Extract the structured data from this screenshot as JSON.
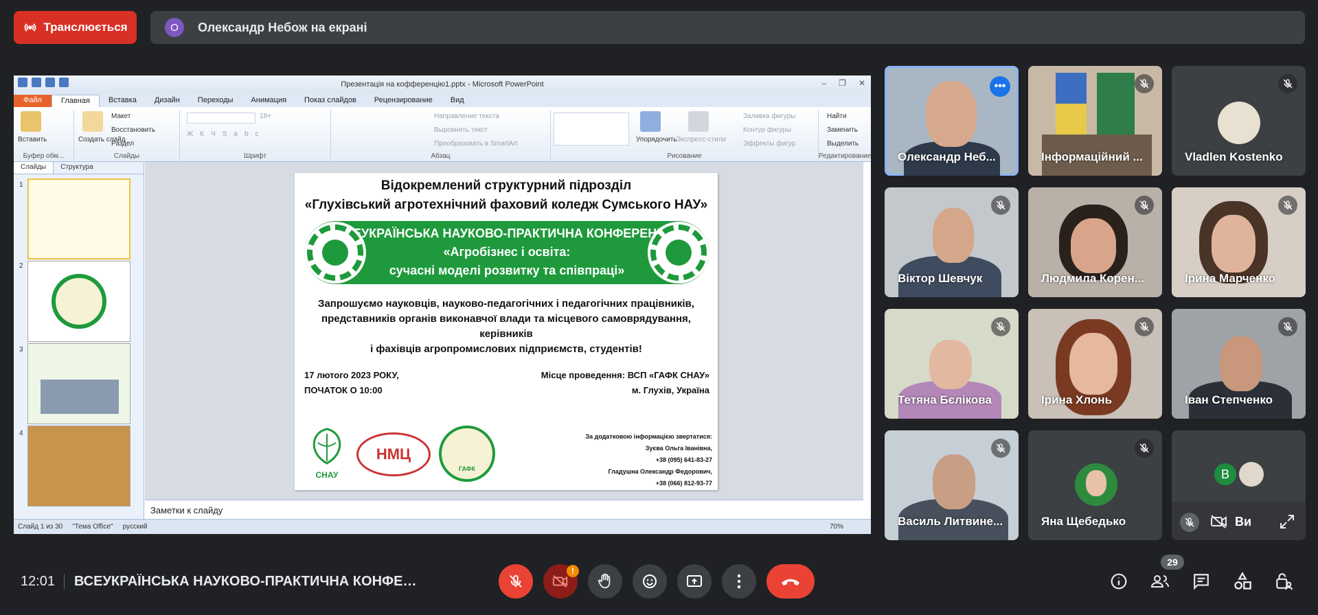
{
  "top": {
    "live_label": "Транслюється",
    "presenter_initial": "О",
    "presenter_text": "Олександр Небож на екрані"
  },
  "ppt": {
    "window_title": "Презентація на кофференцію1.pptx - Microsoft PowerPoint",
    "tabs": [
      "Файл",
      "Главная",
      "Вставка",
      "Дизайн",
      "Переходы",
      "Анимация",
      "Показ слайдов",
      "Рецензирование",
      "Вид"
    ],
    "groups": {
      "clipboard": "Буфер обм...",
      "slides": "Слайды",
      "font": "Шрифт",
      "paragraph": "Абзац",
      "drawing": "Рисование",
      "editing": "Редактирование"
    },
    "ribbon_items": {
      "paste": "Вставить",
      "create": "Создать слайд",
      "layout": "Макет",
      "restore": "Восстановить",
      "section": "Раздел",
      "font_size": "18+",
      "text_dir": "Направление текста",
      "align_text": "Выровнять текст",
      "smartart": "Преобразовать в SmartArt",
      "arrange": "Упорядочить",
      "quick_styles": "Экспресс-стили",
      "fill": "Заливка фигуры",
      "outline": "Контур фигуры",
      "effects": "Эффекты фигур",
      "find": "Найти",
      "replace": "Заменить",
      "select": "Выделить"
    },
    "pane_tabs": [
      "Слайды",
      "Структура"
    ],
    "slide_numbers": [
      "1",
      "2",
      "3",
      "4"
    ],
    "slide": {
      "line1": "Відокремлений структурний підрозділ",
      "line2": "«Глухівський агротехнічний фаховий коледж Сумського НАУ»",
      "banner1": "ВСЕУКРАЇНСЬКА НАУКОВО-ПРАКТИЧНА КОНФЕРЕНЦІЯ",
      "banner2": "«Агробізнес і освіта:",
      "banner3": "сучасні моделі розвитку та співпраці»",
      "invite1": "Запрошуємо науковців, науково-педагогічних і педагогічних працівників,",
      "invite2": "представників органів виконавчої влади та місцевого самоврядування, керівників",
      "invite3": "і фахівців агропромислових підприємств, студентів!",
      "date1": "17 лютого 2023 РОКУ,",
      "date2": "ПОЧАТОК О 10:00",
      "place1": "Місце проведення: ВСП «ГАФК СНАУ»",
      "place2": "м. Глухів, Україна",
      "contact1": "За додатковою інформацією звертатися:",
      "contact2": "Зуєва Ольга Іванівна,",
      "contact3": "+38 (095) 641-83-27",
      "contact4": "Гладушна Олександр Федорович,",
      "contact5": "+38 (066) 812-93-77",
      "logo1": "СНАУ",
      "logo2": "НМЦ",
      "logo3": "ГАФК"
    },
    "notes_placeholder": "Заметки к слайду",
    "status": {
      "slide": "Слайд 1 из 30",
      "theme": "\"Тема Office\"",
      "lang": "русский",
      "zoom": "70%"
    }
  },
  "participants": [
    {
      "name": "Олександр Неб...",
      "muted": false,
      "active": true
    },
    {
      "name": "Інформаційний ...",
      "muted": true
    },
    {
      "name": "Vladlen Kostenko",
      "muted": true
    },
    {
      "name": "Віктор Шевчук",
      "muted": true
    },
    {
      "name": "Людмила Корен...",
      "muted": true
    },
    {
      "name": "Ірина Марченко",
      "muted": true
    },
    {
      "name": "Тетяна Бєлікова",
      "muted": true
    },
    {
      "name": "Ірина Хлонь",
      "muted": true
    },
    {
      "name": "Іван Степченко",
      "muted": true
    },
    {
      "name": "Василь Литвине...",
      "muted": true
    },
    {
      "name": "Яна Щебедько",
      "muted": true
    }
  ],
  "others_tile": {
    "initial": "В",
    "text": "Ви"
  },
  "bottom": {
    "time": "12:01",
    "meeting_title": "ВСЕУКРАЇНСЬКА НАУКОВО-ПРАКТИЧНА КОНФЕР...",
    "warning": "!",
    "participants_count": "29"
  },
  "colors": {
    "background": "#202124",
    "surface": "#3c4043",
    "danger": "#ea4335",
    "accent": "#8ab4f8",
    "slide_green": "#1e9a3c"
  }
}
